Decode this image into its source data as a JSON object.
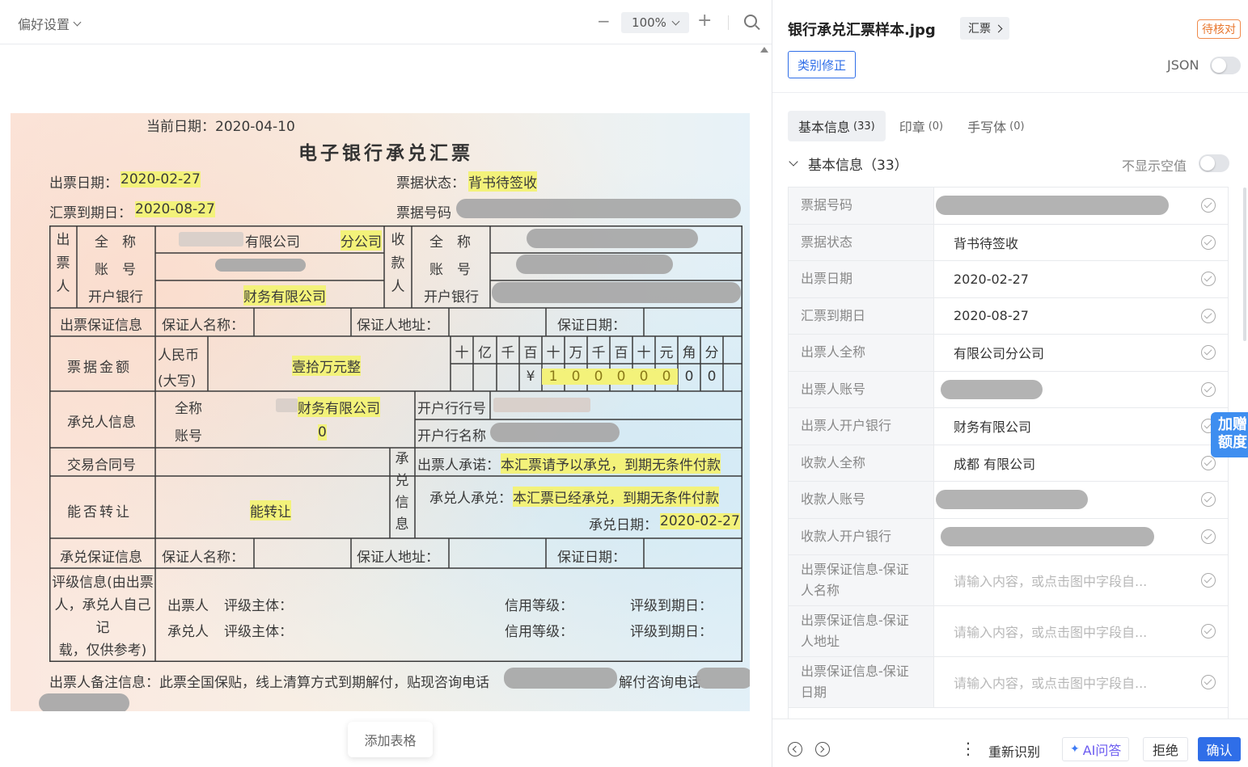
{
  "viewer": {
    "pref_label": "偏好设置",
    "zoom_minus": "−",
    "zoom_value": "100%",
    "zoom_plus": "+",
    "add_table_label": "添加表格"
  },
  "doc": {
    "current_date": "当前日期：2020-04-10",
    "title": "电子银行承兑汇票",
    "issue_date_label": "出票日期：",
    "issue_date": "2020-02-27",
    "status_label": "票据状态：",
    "status": "背书待签收",
    "due_date_label": "汇票到期日：",
    "due_date": "2020-08-27",
    "bill_no_label": "票据号码",
    "drawer": [
      "出",
      "票",
      "人"
    ],
    "payee": [
      "收",
      "款",
      "人"
    ],
    "full_name_label": "全　称",
    "account_label": "账　号",
    "bank_label": "开户银行",
    "drawer_name_a": "有限公司",
    "drawer_name_b": "分公司",
    "drawer_bank": "财务有限公司",
    "guarantee_label": "出票保证信息",
    "guarantor_name_label": "保证人名称：",
    "guarantor_addr_label": "保证人地址：",
    "guarantee_date_label": "保证日期：",
    "amount_label": "票据金额",
    "rmb_label": "人民币",
    "rmb_caps": "(大写)",
    "amount_caps": "壹拾万元整",
    "digit_headers": [
      "十",
      "亿",
      "千",
      "百",
      "十",
      "万",
      "千",
      "百",
      "十",
      "元",
      "角",
      "分"
    ],
    "digit_values": [
      "",
      "",
      "",
      "¥",
      "1",
      "0",
      "0",
      "0",
      "0",
      "0",
      "0",
      "0"
    ],
    "acceptor_label": "承兑人信息",
    "acceptor_full_name": "全称",
    "acceptor_account": "账号",
    "acceptor_name": "财务有限公司",
    "acceptor_account_value": "0",
    "bank_no_label": "开户行行号",
    "bank_name_label": "开户行名称",
    "contract_label": "交易合同号",
    "accept_info": [
      "承",
      "兑",
      "信",
      "息"
    ],
    "drawer_promise_label": "出票人承诺：",
    "drawer_promise": "本汇票请予以承兑，到期无条件付款",
    "transferable_label": "能否转让",
    "transferable": "能转让",
    "acceptor_promise_label": "承兑人承兑：",
    "acceptor_promise": "本汇票已经承兑，到期无条件付款",
    "accept_date_label": "承兑日期：",
    "accept_date": "2020-02-27",
    "acc_guarantee_label": "承兑保证信息",
    "rating_label": [
      "评级信息(由出票",
      "人，承兑人自己",
      "记",
      "载，仅供参考)"
    ],
    "rating_drawer": "出票人",
    "rating_acceptor": "承兑人",
    "rating_subject": "评级主体：",
    "credit_level": "信用等级：",
    "rating_due": "评级到期日：",
    "remark": "出票人备注信息：此票全国保贴，线上清算方式到期解付，贴现咨询电话",
    "remark_tail": "解付咨询电话"
  },
  "panel": {
    "file_name": "银行承兑汇票样本.jpg",
    "type_tag": "汇票",
    "status_badge": "待核对",
    "fix_button": "类别修正",
    "json_label": "JSON",
    "tabs": [
      {
        "label": "基本信息",
        "count": "(33)"
      },
      {
        "label": "印章",
        "count": "(0)"
      },
      {
        "label": "手写体",
        "count": "(0)"
      }
    ],
    "section_title": "基本信息（33）",
    "hide_empty_label": "不显示空值",
    "quota_button": "加赠额度",
    "placeholder": "请输入内容，或点击图中字段自...",
    "fields": [
      {
        "label": "票据号码",
        "value": ""
      },
      {
        "label": "票据状态",
        "value": "背书待签收"
      },
      {
        "label": "出票日期",
        "value": "2020-02-27"
      },
      {
        "label": "汇票到期日",
        "value": "2020-08-27"
      },
      {
        "label": "出票人全称",
        "value": "有限公司分公司"
      },
      {
        "label": "出票人账号",
        "value": ""
      },
      {
        "label": "出票人开户银行",
        "value": "财务有限公司"
      },
      {
        "label": "收款人全称",
        "value": "成都 有限公司"
      },
      {
        "label": "收款人账号",
        "value": ""
      },
      {
        "label": "收款人开户银行",
        "value": ""
      },
      {
        "label": "出票保证信息-保证人名称",
        "value": ""
      },
      {
        "label": "出票保证信息-保证人地址",
        "value": ""
      },
      {
        "label": "出票保证信息-保证日期",
        "value": ""
      }
    ],
    "footer": {
      "more": "⋮",
      "re_recognize": "重新识别",
      "ai_spark": "✦",
      "ai_label": "AI问答",
      "reject": "拒绝",
      "confirm": "确认"
    }
  }
}
